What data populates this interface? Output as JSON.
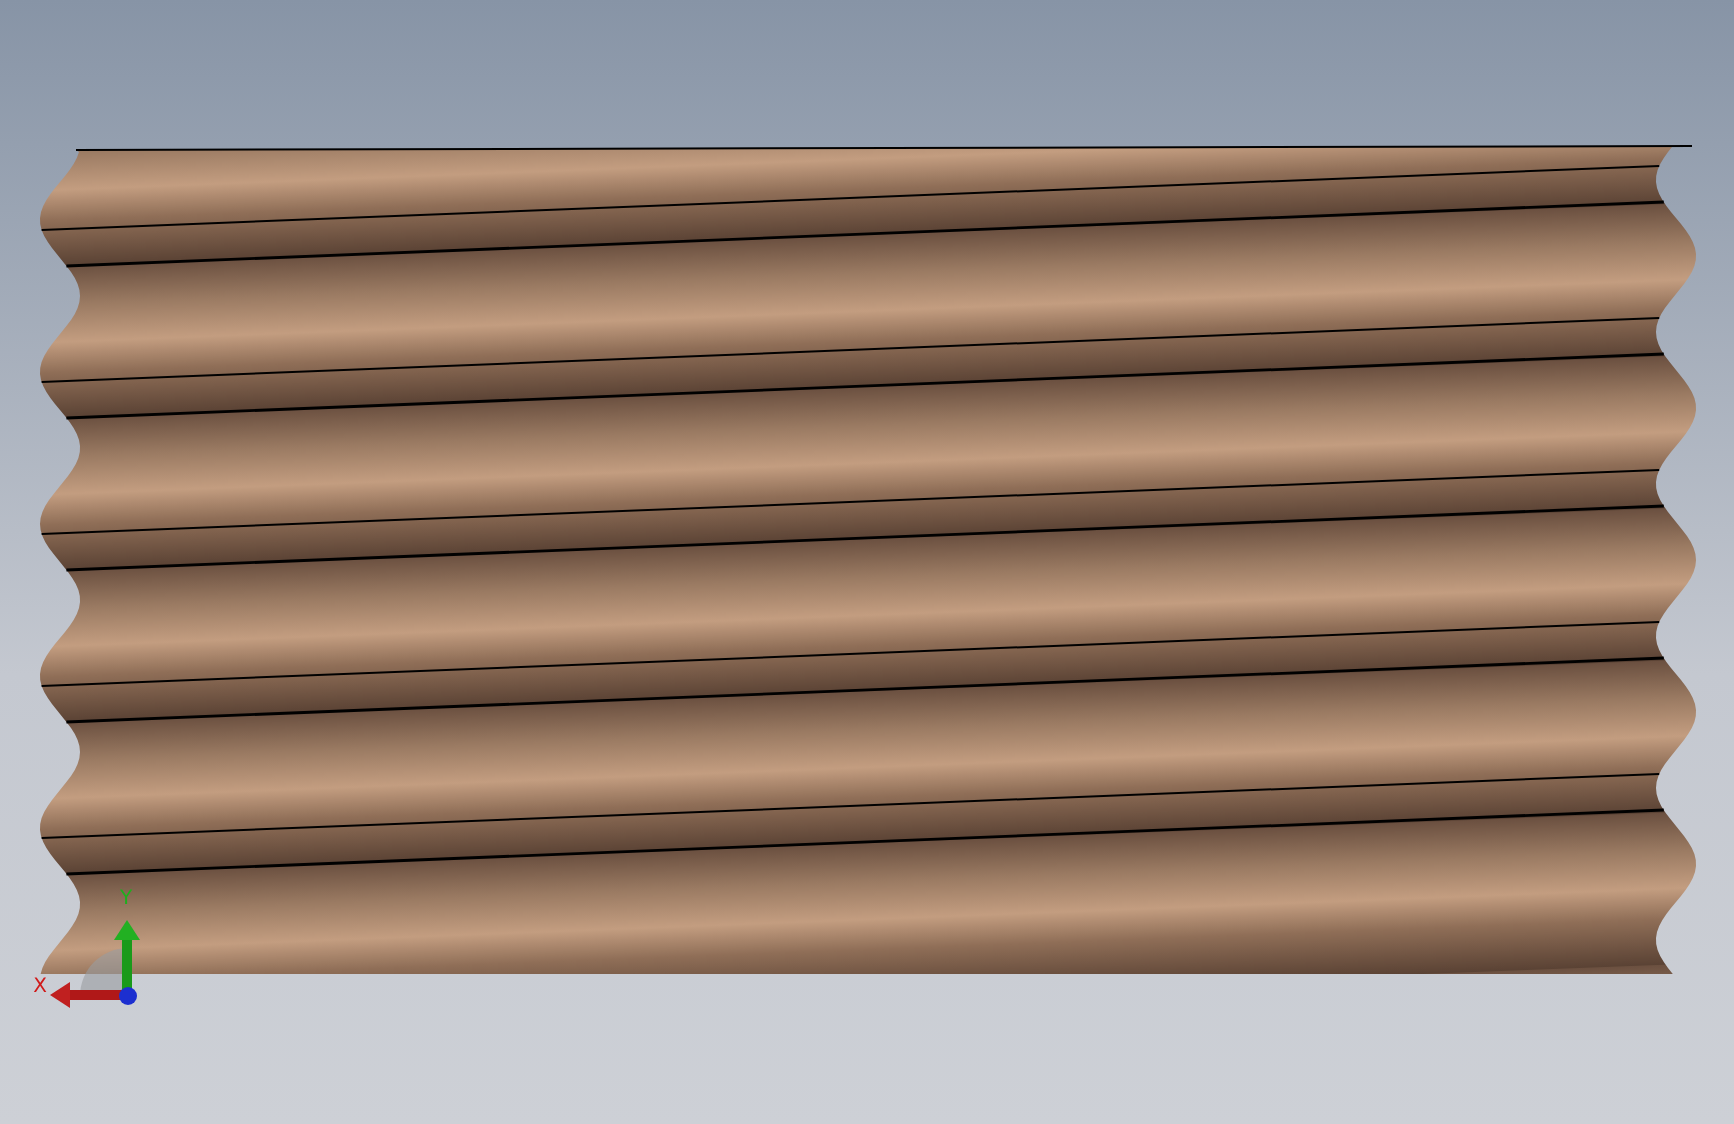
{
  "viewport": {
    "triad": {
      "x_label": "X",
      "y_label": "Y"
    }
  }
}
